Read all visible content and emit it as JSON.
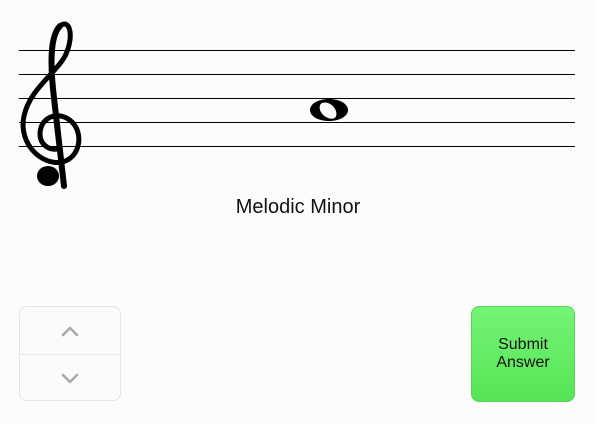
{
  "staff": {
    "clef_icon": "treble-clef-icon",
    "note_icon": "whole-note-icon"
  },
  "scale": {
    "label": "Melodic Minor"
  },
  "stepper": {
    "up_icon": "chevron-up-icon",
    "down_icon": "chevron-down-icon"
  },
  "actions": {
    "submit_label": "Submit Answer"
  },
  "colors": {
    "submit_bg": "#66ea66",
    "staff_lines": "#000000",
    "chevron": "#a8a8a8"
  }
}
